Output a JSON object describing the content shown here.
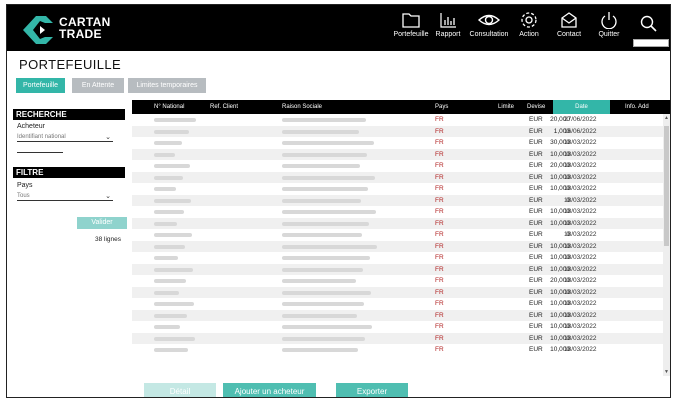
{
  "brand": {
    "line1": "CARTAN",
    "line2": "TRADE"
  },
  "nav": [
    {
      "label": "Portefeuille",
      "icon": "folder-icon"
    },
    {
      "label": "Rapport",
      "icon": "bar-chart-icon"
    },
    {
      "label": "Consultation",
      "icon": "eye-icon"
    },
    {
      "label": "Action",
      "icon": "gear-icon"
    },
    {
      "label": "Contact",
      "icon": "mail-icon"
    },
    {
      "label": "Quitter",
      "icon": "power-icon"
    }
  ],
  "page_title": "PORTEFEUILLE",
  "tabs": [
    {
      "label": "Portefeuille",
      "active": true
    },
    {
      "label": "En Attente",
      "active": false
    },
    {
      "label": "Limites temporaires",
      "active": false
    }
  ],
  "search": {
    "heading": "RECHERCHE",
    "buyer_label": "Acheteur",
    "buyer_select": "Identifiant national"
  },
  "filter": {
    "heading": "FILTRE",
    "country_label": "Pays",
    "country_select": "Tous"
  },
  "validate_label": "Valider",
  "line_count": "38 lignes",
  "table": {
    "columns": [
      "N° National",
      "Ref. Client",
      "Raison Sociale",
      "Pays",
      "Limite",
      "Devise",
      "Date",
      "Info. Add"
    ],
    "rows": [
      {
        "pays": "FR",
        "limite": "20,000",
        "devise": "EUR",
        "date": "27/06/2022"
      },
      {
        "pays": "FR",
        "limite": "1,000",
        "devise": "EUR",
        "date": "16/06/2022"
      },
      {
        "pays": "FR",
        "limite": "30,000",
        "devise": "EUR",
        "date": "18/03/2022"
      },
      {
        "pays": "FR",
        "limite": "10,000",
        "devise": "EUR",
        "date": "18/03/2022"
      },
      {
        "pays": "FR",
        "limite": "20,000",
        "devise": "EUR",
        "date": "18/03/2022"
      },
      {
        "pays": "FR",
        "limite": "10,000",
        "devise": "EUR",
        "date": "18/03/2022"
      },
      {
        "pays": "FR",
        "limite": "10,000",
        "devise": "EUR",
        "date": "18/03/2022"
      },
      {
        "pays": "FR",
        "limite": "0",
        "devise": "EUR",
        "date": "18/03/2022"
      },
      {
        "pays": "FR",
        "limite": "10,000",
        "devise": "EUR",
        "date": "18/03/2022"
      },
      {
        "pays": "FR",
        "limite": "10,000",
        "devise": "EUR",
        "date": "18/03/2022"
      },
      {
        "pays": "FR",
        "limite": "0",
        "devise": "EUR",
        "date": "18/03/2022"
      },
      {
        "pays": "FR",
        "limite": "10,000",
        "devise": "EUR",
        "date": "18/03/2022"
      },
      {
        "pays": "FR",
        "limite": "10,000",
        "devise": "EUR",
        "date": "18/03/2022"
      },
      {
        "pays": "FR",
        "limite": "10,000",
        "devise": "EUR",
        "date": "18/03/2022"
      },
      {
        "pays": "FR",
        "limite": "20,000",
        "devise": "EUR",
        "date": "18/03/2022"
      },
      {
        "pays": "FR",
        "limite": "10,000",
        "devise": "EUR",
        "date": "18/03/2022"
      },
      {
        "pays": "FR",
        "limite": "10,000",
        "devise": "EUR",
        "date": "18/03/2022"
      },
      {
        "pays": "FR",
        "limite": "10,000",
        "devise": "EUR",
        "date": "18/03/2022"
      },
      {
        "pays": "FR",
        "limite": "10,000",
        "devise": "EUR",
        "date": "18/03/2022"
      },
      {
        "pays": "FR",
        "limite": "10,000",
        "devise": "EUR",
        "date": "18/03/2022"
      },
      {
        "pays": "FR",
        "limite": "10,000",
        "devise": "EUR",
        "date": "18/03/2022"
      }
    ]
  },
  "buttons": {
    "detail": "Détail",
    "add_buyer": "Ajouter un acheteur",
    "export": "Exporter"
  },
  "colors": {
    "accent": "#33b6a8",
    "accent_light": "#8fd3cd",
    "tab_inactive": "#b7bcc0",
    "country_red": "#b02020"
  }
}
